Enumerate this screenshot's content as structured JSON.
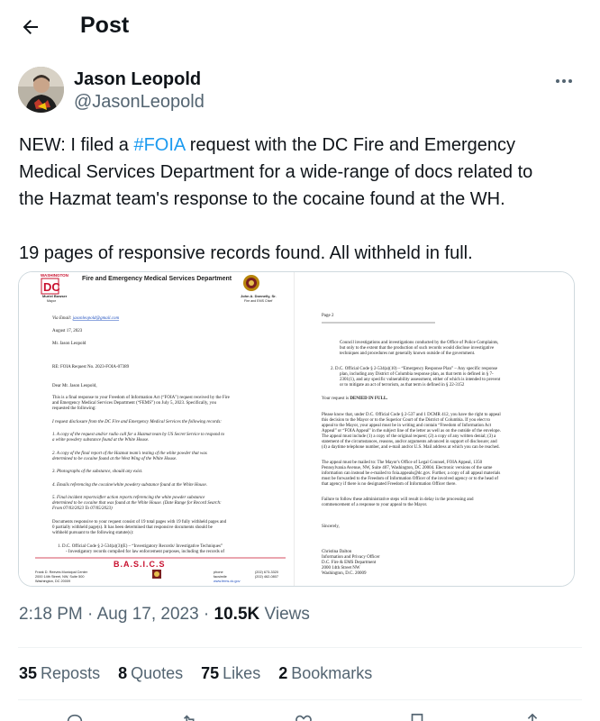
{
  "header": {
    "title": "Post"
  },
  "author": {
    "name": "Jason Leopold",
    "handle": "@JasonLeopold"
  },
  "tweet": {
    "line1_pre": "NEW: I filed a ",
    "hashtag": "#FOIA",
    "line1_post": " request with the DC Fire and Emergency",
    "line2": "Medical Services Department for a wide-range of docs related to",
    "line3": "the Hazmat team's response to the cocaine found at the WH.",
    "line4": "19 pages of responsive records found. All withheld  in full."
  },
  "document": {
    "top_label": "WASHINGTON",
    "dc_logo": "DC",
    "mayor_name": "Muriel Bowser",
    "mayor_title": "Mayor",
    "department": "Fire and Emergency Medical Services Department",
    "chief_name": "John A. Donnelly, Sr.",
    "chief_title": "Fire and EMS Chief",
    "page1": {
      "via_email_label": "Via Email: ",
      "via_email": "jasonleopold@gmail.com",
      "date": "August 17, 2023",
      "recipient": "Mr. Jason Leopold",
      "re_line": "RE: FOIA Request No. 2023-FOIA-07389",
      "salutation": "Dear Mr. Jason Leopold,",
      "para1_1": "This is a final response to your Freedom of Information Act (“FOIA”) request received by the Fire",
      "para1_2": "and Emergency Medical Services Department (“FEMS”) on July 5, 2023. Specifically, you",
      "para1_3": "requested the following:",
      "req_intro": "I request disclosure from the DC Fire and Emergency Medical Services the following records:",
      "item1_1": "1. A copy of the request and/or radio call for a Hazmat team by US Secret Service to respond to",
      "item1_2": "a white powdery substance found at the White House.",
      "item2_1": "2. A copy of the final report of the Hazmat team's testing of the white powder that was",
      "item2_2": "determined to be cocaine found at the West Wing of the White House.",
      "item3": "3. Photographs of the substance, should any exist.",
      "item4": "4. Emails referencing the cocaine/white powdery substance found at the White House.",
      "item5_1": "5. Final incident reports/after action reports referencing the white powder substance",
      "item5_2": "determined to be cocaine that was found at the White House.  (Date Range for Record Search:",
      "item5_3": "From 07/03/2023 To 07/05/2023)",
      "resp_1": "Documents responsive to your request consist of 19 total pages with 19 fully withheld pages and",
      "resp_2": "0 partially withheld page(s). It has been determined that responsive documents should be",
      "resp_3": "withheld pursuant to the following statute(s):",
      "code_1": "1.   D.C. Official Code § 2-534(a)(3)(E) – “Investigatory Records/ Investigative Techniques”",
      "code_2": "- Investigatory records compiled for law enforcement purposes, including the records of",
      "footer_addr1": "Frank D. Reeves Municipal Center",
      "footer_addr2": "2000 14th Street, NW, Suite 500",
      "footer_addr3": "Washington, DC 20009",
      "footer_basics": "B.A.S.I.C.S",
      "footer_phone_label": "phone",
      "footer_fax_label": "facsimile",
      "footer_web": "www.fems.dc.gov",
      "footer_phone": "(202) 673-3320",
      "footer_fax": "(202) 462-0807"
    },
    "page2": {
      "page_label": "Page 2",
      "cont_1": "Council investigations and investigations conducted by the Office of Police Complaints,",
      "cont_2": "but only to the extent that the production of such records would disclose investigative",
      "cont_3": "techniques and procedures not generally known outside of the government.",
      "code2_1": "2.   D.C. Official Code § 2-534(a)(10) – “Emergency Response Plan” – Any specific response",
      "code2_2": "plan, including any District of Columbia response plan, as that term is defined in § 7-",
      "code2_3": "2301(1), and any specific vulnerability assessment, either of which is intended to prevent",
      "code2_4": "or to mitigate an act of terrorism, as that term is defined in § 22-3152",
      "denied_pre": "Your request is ",
      "denied": "DENIED IN FULL.",
      "appeal_1": "Please know that, under D.C. Official Code § 2-537 and 1 DCMR 412, you have the right to appeal",
      "appeal_2": "this decision to the Mayor or to the Superior Court of the District of Columbia. If you elect to",
      "appeal_3": "appeal to the Mayor, your appeal must be in writing and contain “Freedom of Information Act",
      "appeal_4": "Appeal” or “FOIA Appeal” in the subject line of the letter as well as on the outside of the envelope.",
      "appeal_5": "The appeal must include (1) a copy of the original request; (2) a copy of any written denial; (3) a",
      "appeal_6": "statement of the circumstances, reasons, and/or arguments advanced in support of disclosure; and",
      "appeal_7": "(4) a daytime telephone number, and e-mail and/or U.S. Mail address at which you can be reached.",
      "mail_1": "The appeal must be mailed to: The Mayor's Office of Legal Counsel, FOIA Appeal, 1350",
      "mail_2": "Pennsylvania Avenue, NW, Suite 407, Washington, DC 20004. Electronic versions of the same",
      "mail_3": "information can instead be e-mailed to foia.appeals@dc.gov. Further, a copy of all appeal materials",
      "mail_4": "must be forwarded to the Freedom of Information Officer of the involved agency or to the head of",
      "mail_5": "that agency if there is no designated Freedom of Information Officer there.",
      "fail_1": "Failure to follow these administrative steps will result in delay in the processing and",
      "fail_2": "commencement of a response to your appeal to the Mayor.",
      "closing": "Sincerely,",
      "sig_name": "Christina Dalton",
      "sig_title": "Information and Privacy Officer",
      "sig_org": "D.C. Fire & EMS Department",
      "sig_addr": "2000 14th Street NW",
      "sig_city": "Washington, D.C. 20009"
    }
  },
  "meta": {
    "time": "2:18 PM",
    "sep1": " · ",
    "date": "Aug 17, 2023",
    "sep2": " · ",
    "views_count": "10.5K",
    "views_label": " Views"
  },
  "stats": {
    "reposts_count": "35",
    "reposts_label": "Reposts",
    "quotes_count": "8",
    "quotes_label": "Quotes",
    "likes_count": "75",
    "likes_label": "Likes",
    "bookmarks_count": "2",
    "bookmarks_label": "Bookmarks"
  },
  "colors": {
    "accent": "#1d9bf0",
    "text": "#0f1419",
    "muted": "#536471",
    "border": "#eff3f4",
    "dc_red": "#c8102e"
  }
}
